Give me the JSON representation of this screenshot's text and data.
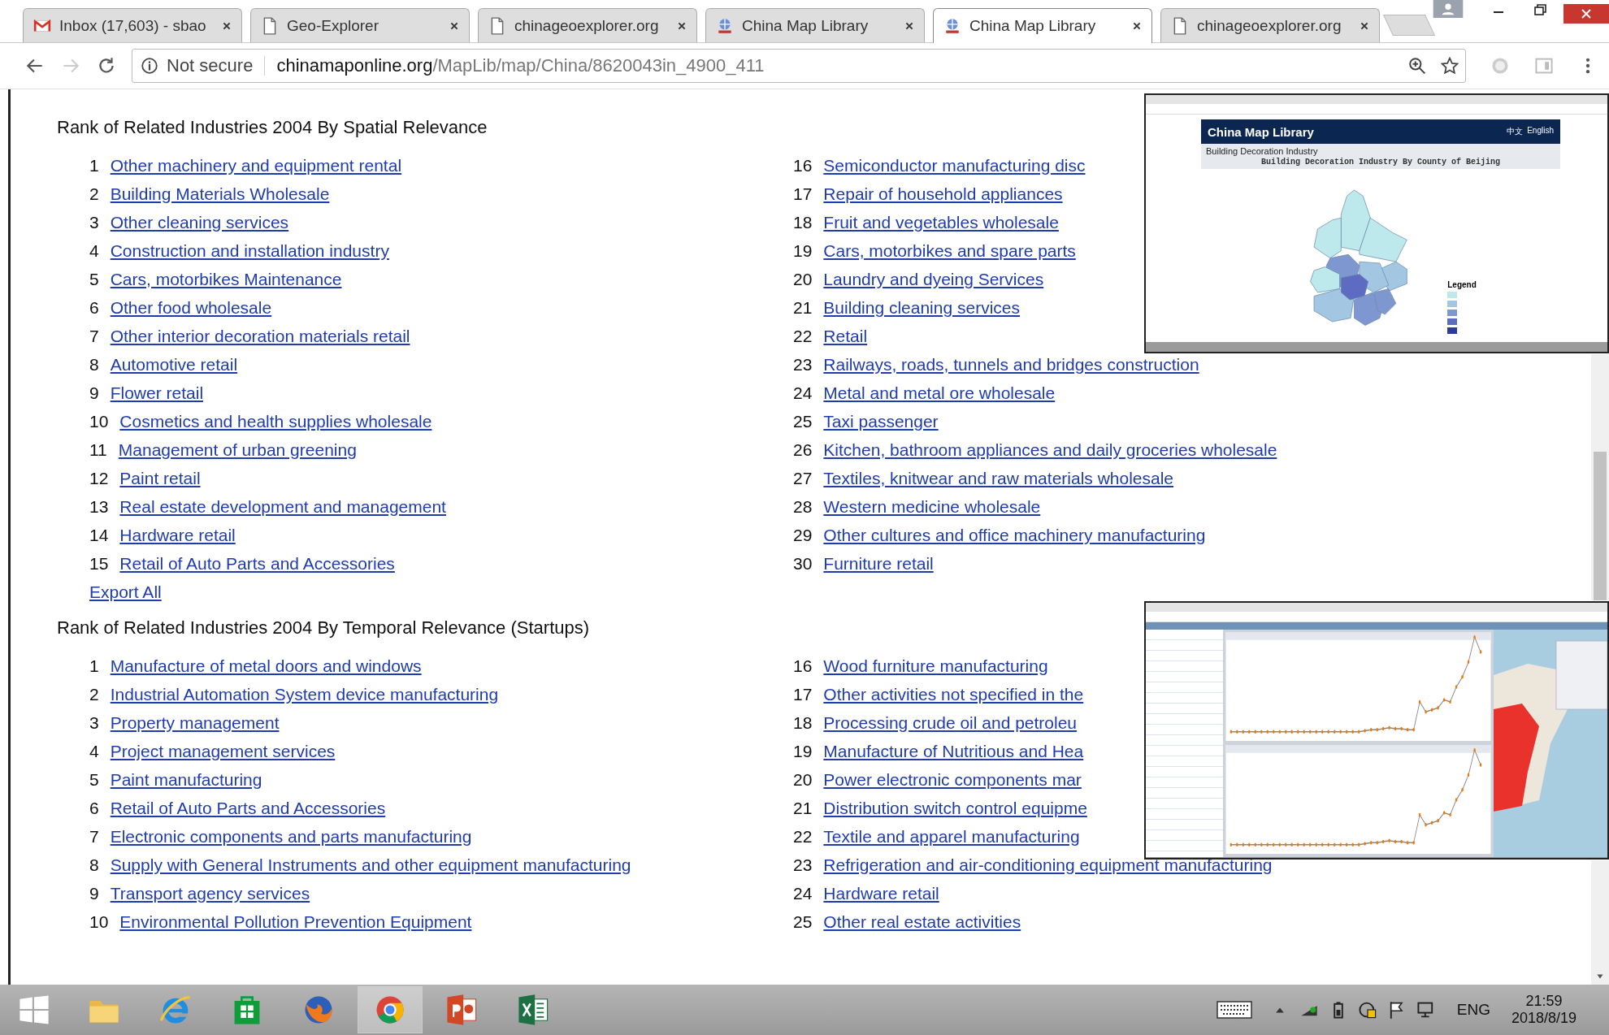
{
  "browser": {
    "tabs": [
      {
        "title": "Inbox (17,603) - sbao",
        "kind": "mail",
        "selected": false
      },
      {
        "title": "Geo-Explorer",
        "kind": "page",
        "selected": false
      },
      {
        "title": "chinageoexplorer.org",
        "kind": "page",
        "selected": false
      },
      {
        "title": "China Map Library",
        "kind": "map",
        "selected": false
      },
      {
        "title": "China Map Library",
        "kind": "map",
        "selected": true
      },
      {
        "title": "chinageoexplorer.org",
        "kind": "page",
        "selected": false
      }
    ],
    "address": {
      "security": "Not secure",
      "host": "chinamaponline.org",
      "path": "/MapLib/map/China/8620043in_4900_411"
    }
  },
  "sections": [
    {
      "heading": "Rank of Related Industries 2004 By Spatial Relevance",
      "export": "Export All",
      "left": [
        {
          "rank": "1",
          "name": "Other machinery and equipment rental"
        },
        {
          "rank": "2",
          "name": "Building Materials Wholesale"
        },
        {
          "rank": "3",
          "name": "Other cleaning services"
        },
        {
          "rank": "4",
          "name": "Construction and installation industry"
        },
        {
          "rank": "5",
          "name": "Cars, motorbikes Maintenance"
        },
        {
          "rank": "6",
          "name": "Other food wholesale"
        },
        {
          "rank": "7",
          "name": "Other interior decoration materials retail"
        },
        {
          "rank": "8",
          "name": "Automotive retail"
        },
        {
          "rank": "9",
          "name": "Flower retail"
        },
        {
          "rank": "10",
          "name": "Cosmetics and health supplies wholesale"
        },
        {
          "rank": "11",
          "name": "Management of urban greening"
        },
        {
          "rank": "12",
          "name": "Paint retail"
        },
        {
          "rank": "13",
          "name": "Real estate development and management"
        },
        {
          "rank": "14",
          "name": "Hardware retail"
        },
        {
          "rank": "15",
          "name": "Retail of Auto Parts and Accessories"
        }
      ],
      "right": [
        {
          "rank": "16",
          "name": "Semiconductor manufacturing disc"
        },
        {
          "rank": "17",
          "name": "Repair of household appliances"
        },
        {
          "rank": "18",
          "name": "Fruit and vegetables wholesale"
        },
        {
          "rank": "19",
          "name": "Cars, motorbikes and spare parts"
        },
        {
          "rank": "20",
          "name": "Laundry and dyeing Services"
        },
        {
          "rank": "21",
          "name": "Building cleaning services"
        },
        {
          "rank": "22",
          "name": "Retail"
        },
        {
          "rank": "23",
          "name": "Railways, roads, tunnels and bridges construction"
        },
        {
          "rank": "24",
          "name": "Metal and metal ore wholesale"
        },
        {
          "rank": "25",
          "name": "Taxi passenger"
        },
        {
          "rank": "26",
          "name": "Kitchen, bathroom appliances and daily groceries wholesale"
        },
        {
          "rank": "27",
          "name": "Textiles, knitwear and raw materials wholesale"
        },
        {
          "rank": "28",
          "name": "Western medicine wholesale"
        },
        {
          "rank": "29",
          "name": "Other cultures and office machinery manufacturing"
        },
        {
          "rank": "30",
          "name": "Furniture retail"
        }
      ]
    },
    {
      "heading": "Rank of Related Industries 2004 By Temporal Relevance (Startups)",
      "left": [
        {
          "rank": "1",
          "name": "Manufacture of metal doors and windows"
        },
        {
          "rank": "2",
          "name": "Industrial Automation System device manufacturing"
        },
        {
          "rank": "3",
          "name": "Property management"
        },
        {
          "rank": "4",
          "name": "Project management services"
        },
        {
          "rank": "5",
          "name": "Paint manufacturing"
        },
        {
          "rank": "6",
          "name": "Retail of Auto Parts and Accessories"
        },
        {
          "rank": "7",
          "name": "Electronic components and parts manufacturing"
        },
        {
          "rank": "8",
          "name": "Supply with General Instruments and other equipment manufacturing"
        },
        {
          "rank": "9",
          "name": "Transport agency services"
        },
        {
          "rank": "10",
          "name": "Environmental Pollution Prevention Equipment"
        }
      ],
      "right": [
        {
          "rank": "16",
          "name": "Wood furniture manufacturing"
        },
        {
          "rank": "17",
          "name": "Other activities not specified in the"
        },
        {
          "rank": "18",
          "name": "Processing crude oil and petroleu"
        },
        {
          "rank": "19",
          "name": "Manufacture of Nutritious and Hea"
        },
        {
          "rank": "20",
          "name": "Power electronic components mar"
        },
        {
          "rank": "21",
          "name": "Distribution switch control equipme"
        },
        {
          "rank": "22",
          "name": "Textile and apparel manufacturing"
        },
        {
          "rank": "23",
          "name": "Refrigeration and air-conditioning equipment manufacturing"
        },
        {
          "rank": "24",
          "name": "Hardware retail"
        },
        {
          "rank": "25",
          "name": "Other real estate activities"
        }
      ]
    }
  ],
  "insets": [
    {
      "kind": "map",
      "title": "China Map Library",
      "languages": [
        "中文",
        "English"
      ],
      "subtitle": "Building Decoration Industry",
      "map_title": "Building Decoration Industry  By County of Beijing",
      "legend_title": "Legend"
    },
    {
      "kind": "charts"
    }
  ],
  "taskbar": {
    "apps": [
      {
        "kind": "explorer",
        "active": false
      },
      {
        "kind": "ie",
        "active": false
      },
      {
        "kind": "store",
        "active": false
      },
      {
        "kind": "firefox",
        "active": false
      },
      {
        "kind": "chrome",
        "active": true
      },
      {
        "kind": "powerpoint",
        "active": false
      },
      {
        "kind": "excel",
        "active": false
      }
    ],
    "language": "ENG",
    "time": "21:59",
    "date": "2018/8/19"
  }
}
